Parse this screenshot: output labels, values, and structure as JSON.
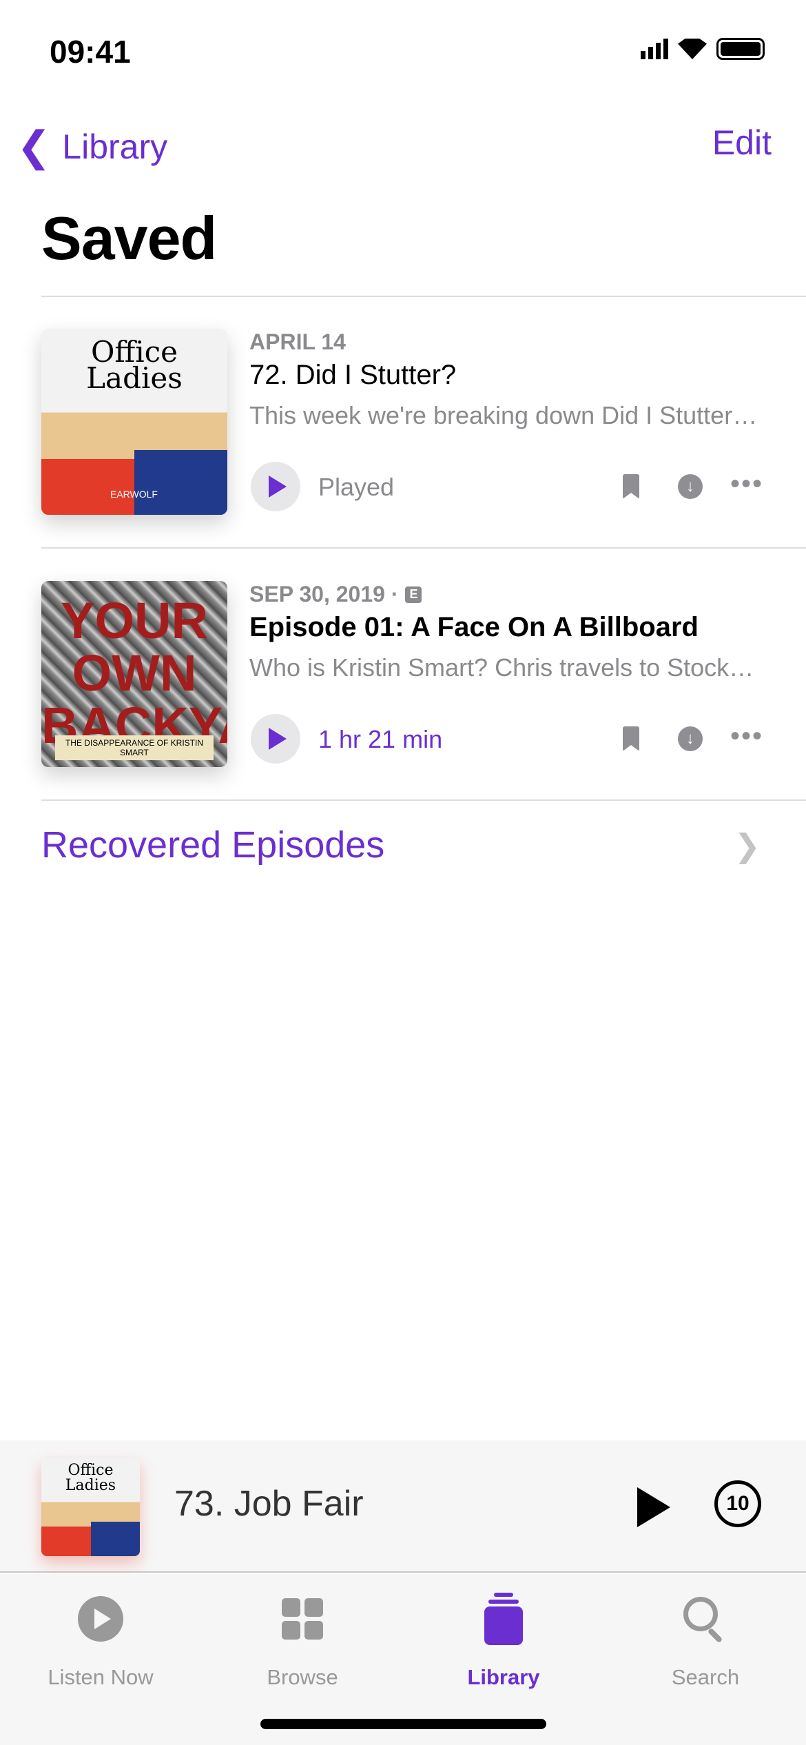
{
  "status": {
    "time": "09:41"
  },
  "nav": {
    "back_label": "Library",
    "edit_label": "Edit"
  },
  "page_title": "Saved",
  "episodes": [
    {
      "date": "APRIL 14",
      "title": "72. Did I Stutter?",
      "description": "This week we're breaking down Did I Stutter? with all the behind-the-scenes stories",
      "status": "Played",
      "artwork_text": "Office Ladies",
      "artwork_brand": "EARWOLF",
      "explicit": false
    },
    {
      "date": "SEP 30, 2019 ·",
      "explicit_badge": "E",
      "title": "Episode 01: A Face On A Billboard",
      "description": "Who is Kristin Smart? Chris travels to Stockton",
      "status": "1 hr 21 min",
      "artwork_text": "YOUR OWN BACKYARD",
      "artwork_sub": "THE DISAPPEARANCE OF KRISTIN SMART",
      "explicit": true
    }
  ],
  "recovered_label": "Recovered Episodes",
  "mini_player": {
    "title": "73. Job Fair",
    "artwork_text": "Office Ladies",
    "skip_label": "10"
  },
  "tabs": [
    {
      "label": "Listen Now",
      "icon": "play-circle-icon"
    },
    {
      "label": "Browse",
      "icon": "grid-icon"
    },
    {
      "label": "Library",
      "icon": "library-icon",
      "active": true
    },
    {
      "label": "Search",
      "icon": "search-icon"
    }
  ],
  "colors": {
    "accent": "#6a2ed1",
    "secondary": "#8a8a8e"
  }
}
